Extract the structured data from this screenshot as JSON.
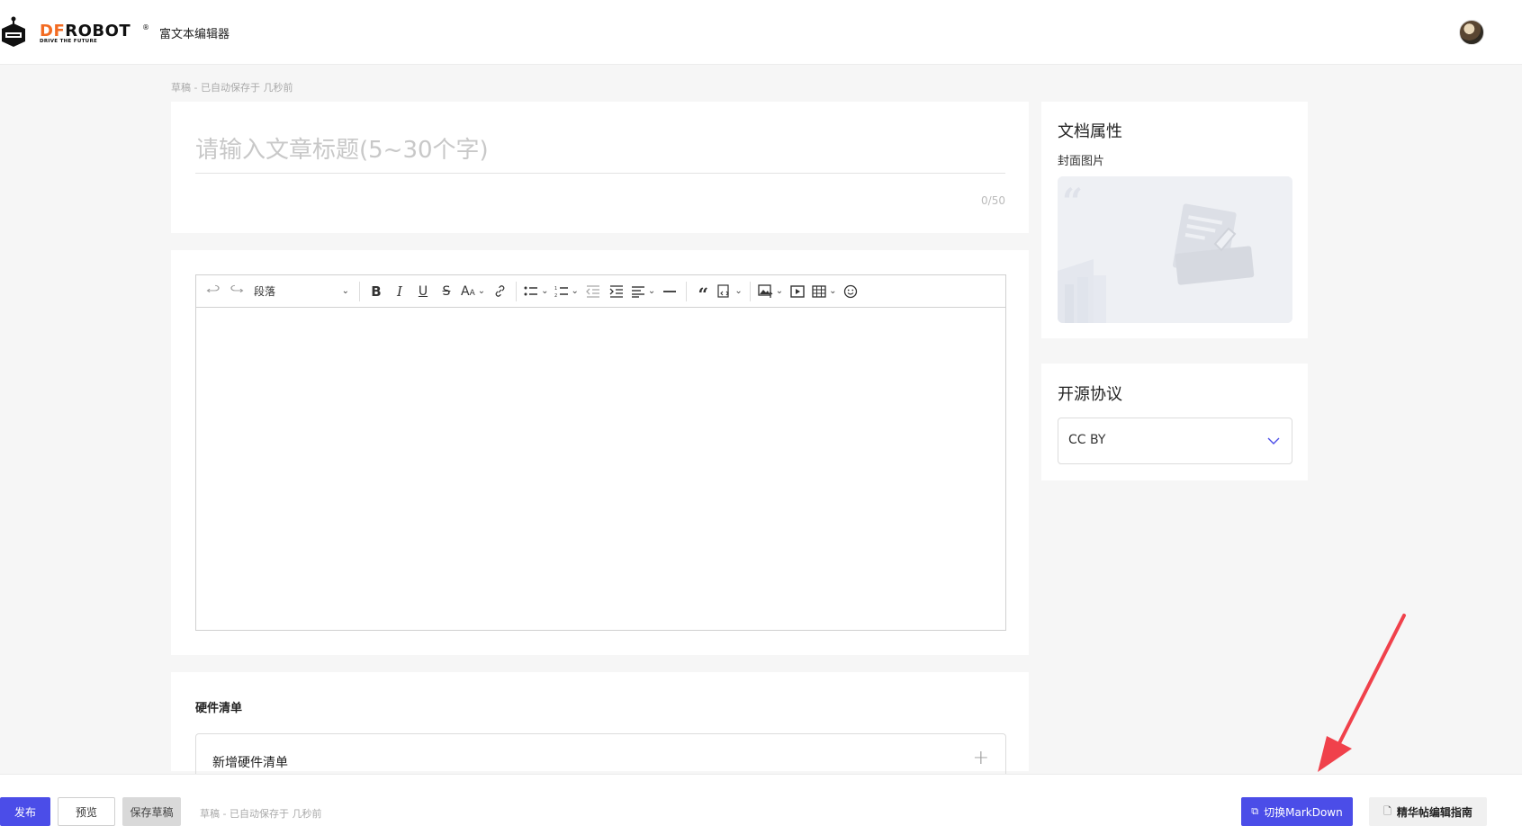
{
  "header": {
    "brand_df": "DF",
    "brand_rest": "ROBOT",
    "brand_reg": "®",
    "brand_tagline": "DRIVE THE FUTURE",
    "app_title": "富文本编辑器"
  },
  "draft_status": "草稿 - 已自动保存于 几秒前",
  "title_field": {
    "placeholder": "请输入文章标题(5~30个字)",
    "value": "",
    "counter": "0/50"
  },
  "toolbar": {
    "paragraph_label": "段落"
  },
  "hardware": {
    "title": "硬件清单",
    "add_label": "新增硬件清单",
    "add_icon": "+"
  },
  "doc_props": {
    "title": "文档属性",
    "cover_label": "封面图片"
  },
  "license": {
    "title": "开源协议",
    "selected": "CC BY"
  },
  "bottom": {
    "publish": "发布",
    "preview": "预览",
    "save_draft": "保存草稿",
    "draft_status": "草稿 - 已自动保存于 几秒前",
    "switch_markdown": "切换MarkDown",
    "guide": "精华帖编辑指南"
  },
  "colors": {
    "accent": "#4b4de8",
    "brand_orange": "#f26b22",
    "annotation_arrow": "#f0414b"
  }
}
